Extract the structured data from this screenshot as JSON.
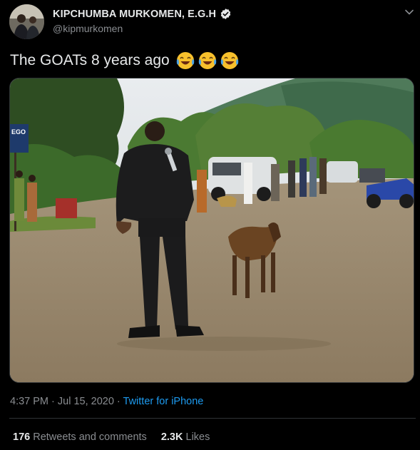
{
  "author": {
    "display_name": "KIPCHUMBA MURKOMEN, E.G.H",
    "handle": "@kipmurkomen",
    "avatar_icon": "profile-photo",
    "verified_icon": "verified-badge-icon"
  },
  "tweet": {
    "text": "The GOATs 8 years ago",
    "emoji_icons": [
      "face-with-tears-of-joy-icon",
      "face-with-tears-of-joy-icon",
      "face-with-tears-of-joy-icon"
    ],
    "media_sign_text": "EGO"
  },
  "meta": {
    "time": "4:37 PM",
    "separator": " · ",
    "date": "Jul 15, 2020",
    "source": "Twitter for iPhone"
  },
  "stats": {
    "retweets_count": "176",
    "retweets_label": "Retweets and comments",
    "likes_count": "2.3K",
    "likes_label": "Likes"
  },
  "colors": {
    "background": "#000000",
    "link": "#1d9bf0",
    "muted": "#8a8d91",
    "text": "#e7e9ea",
    "divider": "#2f3336"
  }
}
